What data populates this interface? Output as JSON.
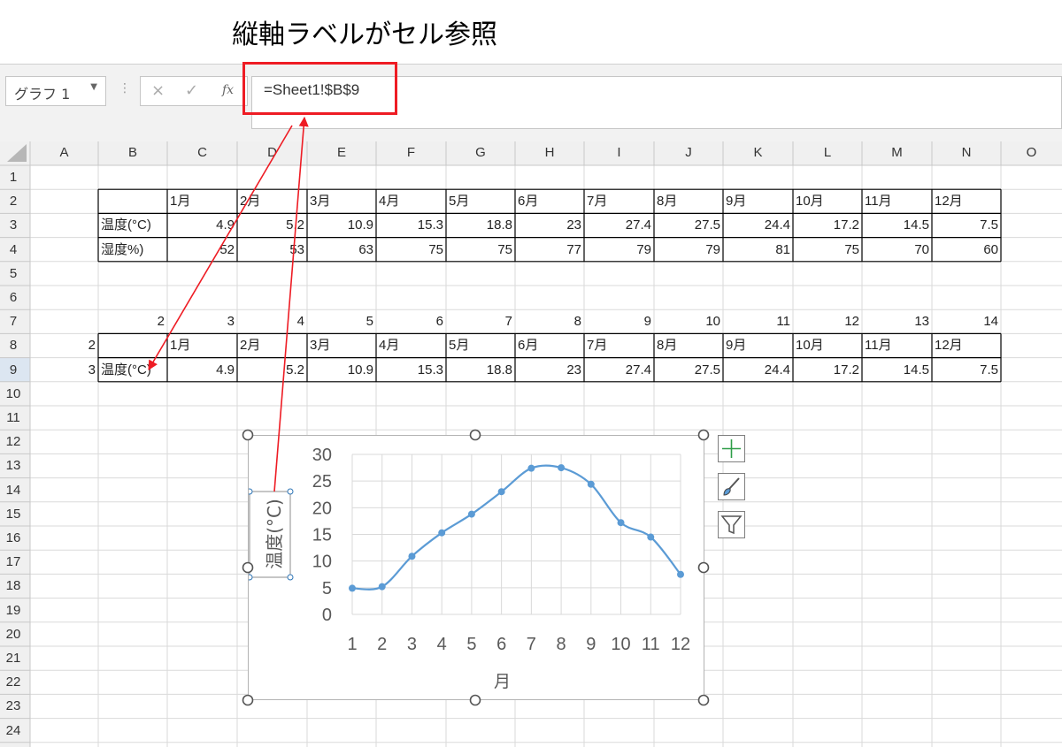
{
  "caption": "縦軸ラベルがセル参照",
  "namebox": {
    "value": "グラフ 1"
  },
  "formula_bar": {
    "cancel_icon": "×",
    "enter_icon": "✓",
    "fx_icon": "fx",
    "value": "=Sheet1!$B$9"
  },
  "columns": [
    "A",
    "B",
    "C",
    "D",
    "E",
    "F",
    "G",
    "H",
    "I",
    "J",
    "K",
    "L",
    "M",
    "N",
    "O"
  ],
  "rows": [
    "1",
    "2",
    "3",
    "4",
    "5",
    "6",
    "7",
    "8",
    "9",
    "10",
    "11",
    "12",
    "13",
    "14",
    "15",
    "16",
    "17",
    "18",
    "19",
    "20",
    "21",
    "22",
    "23",
    "24"
  ],
  "table1": {
    "header": [
      "1月",
      "2月",
      "3月",
      "4月",
      "5月",
      "6月",
      "7月",
      "8月",
      "9月",
      "10月",
      "11月",
      "12月"
    ],
    "rows": [
      {
        "label": "温度(°C)",
        "values": [
          "4.9",
          "5.2",
          "10.9",
          "15.3",
          "18.8",
          "23",
          "27.4",
          "27.5",
          "24.4",
          "17.2",
          "14.5",
          "7.5"
        ]
      },
      {
        "label": "湿度%)",
        "values": [
          "52",
          "53",
          "63",
          "75",
          "75",
          "77",
          "79",
          "79",
          "81",
          "75",
          "70",
          "60"
        ]
      }
    ]
  },
  "row7_numbers": [
    "2",
    "3",
    "4",
    "5",
    "6",
    "7",
    "8",
    "9",
    "10",
    "11",
    "12",
    "13",
    "14"
  ],
  "table2": {
    "a8": "2",
    "a9": "3",
    "header": [
      "1月",
      "2月",
      "3月",
      "4月",
      "5月",
      "6月",
      "7月",
      "8月",
      "9月",
      "10月",
      "11月",
      "12月"
    ],
    "row": {
      "label": "温度(°C)",
      "values": [
        "4.9",
        "5.2",
        "10.9",
        "15.3",
        "18.8",
        "23",
        "27.4",
        "27.5",
        "24.4",
        "17.2",
        "14.5",
        "7.5"
      ]
    }
  },
  "chart_data": {
    "type": "line",
    "x": [
      1,
      2,
      3,
      4,
      5,
      6,
      7,
      8,
      9,
      10,
      11,
      12
    ],
    "series": [
      {
        "values": [
          4.9,
          5.2,
          10.9,
          15.3,
          18.8,
          23,
          27.4,
          27.5,
          24.4,
          17.2,
          14.5,
          7.5
        ],
        "color": "#5b9bd5"
      }
    ],
    "xlabel": "月",
    "ylabel": "温度(°C)",
    "ylim": [
      0,
      30
    ],
    "yticks": [
      0,
      5,
      10,
      15,
      20,
      25,
      30
    ],
    "grid": true
  },
  "chart_buttons": [
    {
      "name": "chart-elements-button",
      "icon": "plus-icon"
    },
    {
      "name": "chart-styles-button",
      "icon": "brush-icon"
    },
    {
      "name": "chart-filters-button",
      "icon": "filter-icon"
    }
  ],
  "colors": {
    "annotation": "#ee1c24",
    "line": "#5b9bd5",
    "selected_row": "#dce6f1"
  }
}
